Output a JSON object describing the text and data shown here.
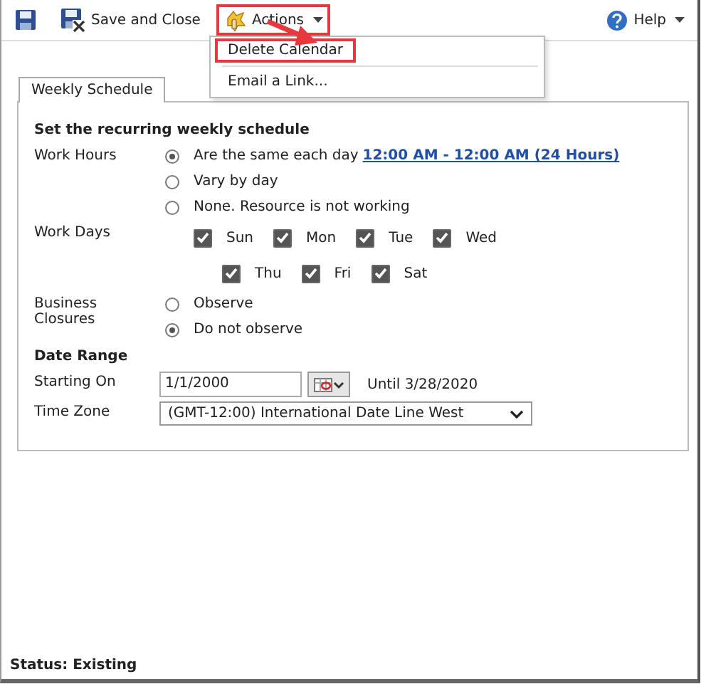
{
  "toolbar": {
    "items": [
      {
        "kind": "save"
      },
      {
        "kind": "save_close",
        "label": "Save and Close"
      },
      {
        "kind": "menu",
        "label": "Actions",
        "expanded": true,
        "highlighted": true
      }
    ],
    "help": {
      "label": "Help"
    }
  },
  "menu": {
    "items": [
      {
        "label": "Delete Calendar",
        "highlighted": true
      },
      {
        "label": "Email a Link...",
        "highlighted": false
      }
    ]
  },
  "tabs": [
    {
      "label": "Weekly Schedule",
      "selected": true
    }
  ],
  "schedule": {
    "heading": "Set the recurring weekly schedule",
    "work_hours": {
      "label": "Work Hours",
      "options": [
        {
          "label": "Are the same each day",
          "link": "12:00 AM - 12:00 AM (24 Hours)",
          "selected": true
        },
        {
          "label": "Vary by day",
          "selected": false
        },
        {
          "label": "None. Resource is not working",
          "selected": false
        }
      ]
    },
    "work_days": {
      "label": "Work Days",
      "rows": [
        [
          {
            "label": "Sun",
            "checked": true
          },
          {
            "label": "Mon",
            "checked": true
          },
          {
            "label": "Tue",
            "checked": true
          },
          {
            "label": "Wed",
            "checked": true
          }
        ],
        [
          {
            "label": "Thu",
            "checked": true
          },
          {
            "label": "Fri",
            "checked": true
          },
          {
            "label": "Sat",
            "checked": true
          }
        ]
      ]
    },
    "business_closures": {
      "label": "Business Closures",
      "options": [
        {
          "label": "Observe",
          "selected": false
        },
        {
          "label": "Do not observe",
          "selected": true
        }
      ]
    }
  },
  "date_range": {
    "heading": "Date Range",
    "starting_on": {
      "label": "Starting On",
      "value": "1/1/2000",
      "until": "Until 3/28/2020"
    },
    "time_zone": {
      "label": "Time Zone",
      "value": "(GMT-12:00) International Date Line West"
    }
  },
  "status_bar": {
    "text": "Status: Existing"
  }
}
